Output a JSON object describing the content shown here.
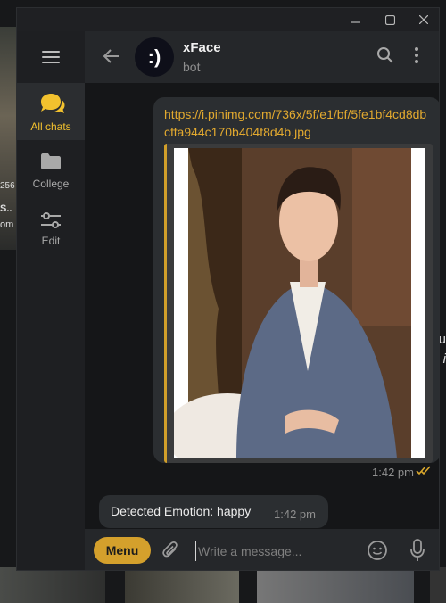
{
  "window": {
    "minimize_glyph": "—",
    "maximize_glyph": "☐",
    "close_glyph": "✕"
  },
  "background": {
    "left_texts": [
      "256",
      "S..",
      "om"
    ],
    "right_texts": [
      "u",
      "i"
    ]
  },
  "sidebar": {
    "folders": [
      {
        "label": "All chats",
        "icon": "chat-bubbles-icon",
        "active": true
      },
      {
        "label": "College",
        "icon": "folder-icon",
        "active": false
      },
      {
        "label": "Edit",
        "icon": "sliders-icon",
        "active": false
      }
    ]
  },
  "header": {
    "avatar_text": ":)",
    "name": "xFace",
    "status": "bot"
  },
  "messages": {
    "outgoing": {
      "link": "https://i.pinimg.com/736x/5f/e1/bf/5fe1bf4cd8dbcffa944c170b404f8d4b.jpg",
      "time": "1:42 pm",
      "status_icon": "double-check-icon"
    },
    "incoming": {
      "text": "Detected Emotion: happy",
      "time": "1:42 pm"
    }
  },
  "composer": {
    "menu_label": "Menu",
    "placeholder": "Write a message..."
  },
  "colors": {
    "accent": "#d4a02c",
    "link": "#e2a92f",
    "bubble": "#2b2e31",
    "background": "#151618"
  }
}
